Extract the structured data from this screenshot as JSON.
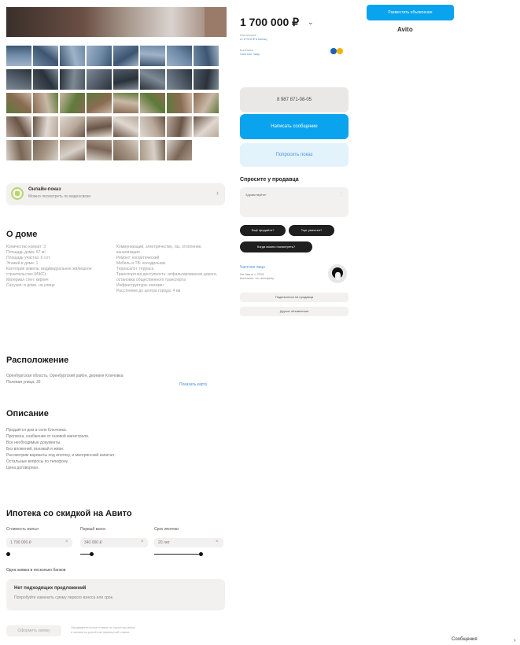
{
  "house": {
    "title": "О доме",
    "left": [
      "Количество комнат: 3",
      "Площадь дома: 67 м²",
      "Площадь участка: 6 сот.",
      "Этажей в доме: 1",
      "Категория земель: индивидуальное жилищное строительство (ИЖС)",
      "Материал стен: кирпич",
      "Санузел: в доме, на улице"
    ],
    "right": [
      "Коммуникации: электричество, газ, отопление, канализация",
      "Ремонт: косметический",
      "Мебель и ТВ: холодильник",
      "Терраса/сн: терраса",
      "Транспортная доступность: асфальтированная дорога, остановка общественного транспорта",
      "Инфраструктура: магазин",
      "Расстояние до центра города: 4 км"
    ]
  },
  "location": {
    "title": "Расположение",
    "lines": [
      "Оренбургская область, Оренбургский район, деревня Ключовка",
      "Полевая улица, 32"
    ],
    "link": "Показать карту"
  },
  "description": {
    "title": "Описание",
    "lines": [
      "Продаётся дом в селе Ключовка.",
      "Прописка, снабжение от газовой магистрали.",
      "Все необходимые документы.",
      "Без вложений, въезжай и живи.",
      "Рассмотрим варианты под ипотеку, и материнский капитал.",
      "Остальные вопросы по телефону.",
      "Цена договорная."
    ]
  },
  "mortgage": {
    "title": "Ипотека со скидкой на Авито",
    "fields": [
      {
        "label": "Стоимость жилья",
        "value": "1 700 000 ₽"
      },
      {
        "label": "Первый взнос",
        "value": "340 000 ₽"
      },
      {
        "label": "Срок ипотеки",
        "value": "20 лет"
      }
    ],
    "bank_label": "Одна заявка в несколько банков",
    "no_offer_title": "Нет подходящих предложений",
    "no_offer_sub": "Попробуйте изменить сумму первого взноса или срок.",
    "apply_label": "Оформить заявку",
    "apply_note": [
      "Предварительные ставки не гарантированы",
      "и являются расчётом примерной ставки."
    ]
  },
  "offer": {
    "price": "1 700 000 ₽",
    "price_info_1": "Ипотечный",
    "price_info_2": "от 8 910 ₽ в месяц",
    "seller_line_1": "Контакты",
    "seller_line_2": "Частное лицо"
  },
  "contact": {
    "phone": "8 987 871-08-05",
    "write": "Написать сообщение",
    "show": "Попросить показ",
    "ask_title": "Спросите у продавца",
    "ask_text": "Здравствуйте!",
    "chips": [
      "Ещё продаёте?",
      "Торг уместен?",
      "Когда можно посмотреть?"
    ]
  },
  "seller": {
    "name": "Частное лицо",
    "info": [
      "На Авито с 2015",
      "Контакты: по телефону"
    ],
    "subscribe": "Подписаться на продавца",
    "other_ads": "Другие объявления"
  },
  "top": {
    "blue_btn": "Разместить объявление",
    "logo": "Avito"
  },
  "footer": {
    "messages": "Сообщения"
  },
  "banner": {
    "title": "Онлайн-показ",
    "sub": "Можно посмотреть по видеосвязи"
  },
  "colors": {
    "accent": "#0aa3ee",
    "link": "#4a90d9",
    "panel": "#f2f1ef"
  }
}
